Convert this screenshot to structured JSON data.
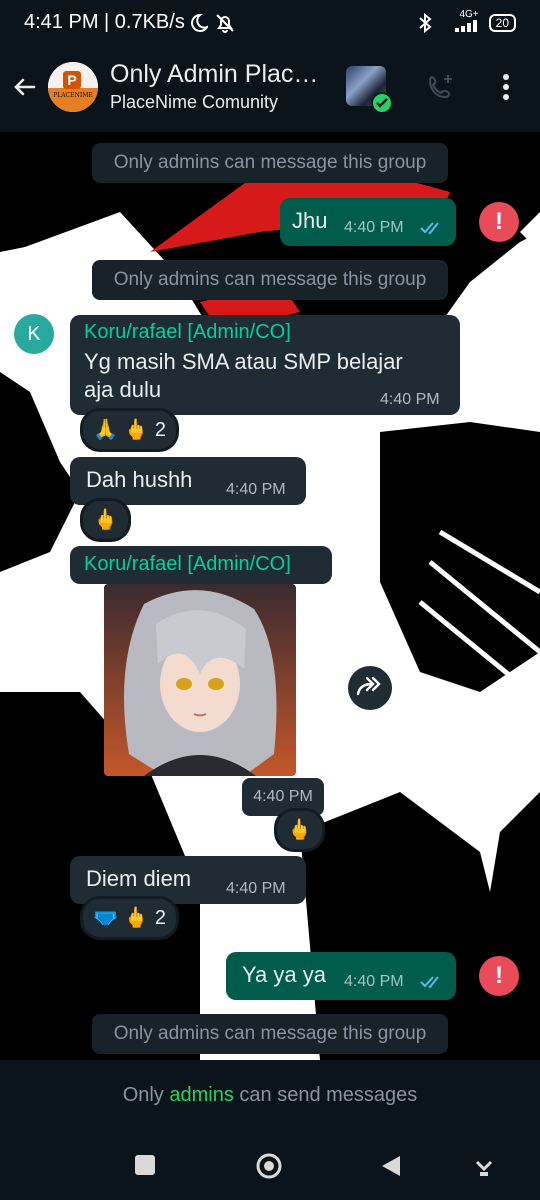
{
  "status_bar": {
    "time": "4:41 PM | 0.7KB/s",
    "network_top": "4G+",
    "battery": "20"
  },
  "header": {
    "title": "Only Admin Plac…",
    "subtitle": "PlaceNime Comunity",
    "avatar_text": "PLACENIME",
    "avatar_letter": "P"
  },
  "messages": {
    "system_1": "Only admins can message this group",
    "out_1": {
      "text": "Jhu",
      "time": "4:40 PM"
    },
    "system_2": "Only admins can message this group",
    "avatar_letter": "K",
    "in_1": {
      "sender": "Koru/rafael [Admin/CO]",
      "line1": "Yg masih SMA atau SMP belajar",
      "line2": "aja dulu",
      "time": "4:40 PM"
    },
    "in_1_reaction": {
      "emoji_1": "🙏",
      "emoji_2": "🖕",
      "count": "2"
    },
    "in_2": {
      "text": "Dah hushh",
      "time": "4:40 PM"
    },
    "in_2_reaction": {
      "emoji_1": "🖕"
    },
    "in_3": {
      "sender": "Koru/rafael [Admin/CO]",
      "time": "4:40 PM"
    },
    "in_3_reaction": {
      "emoji_1": "🖕"
    },
    "in_4": {
      "text": "Diem diem",
      "time": "4:40 PM"
    },
    "in_4_reaction": {
      "emoji_1": "🩲",
      "emoji_2": "🖕",
      "count": "2"
    },
    "out_2": {
      "text": "Ya ya ya",
      "time": "4:40 PM"
    },
    "system_3": "Only admins can message this group",
    "error_mark": "!"
  },
  "footer": {
    "only_prefix": "Only",
    "admins_link": "admins",
    "suffix": "can send messages"
  },
  "colors": {
    "header_bg": "#0b141a",
    "out_bubble": "#005c4b",
    "in_bubble": "#202c33",
    "accent_green": "#25d366",
    "error_red": "#ea4b59"
  }
}
